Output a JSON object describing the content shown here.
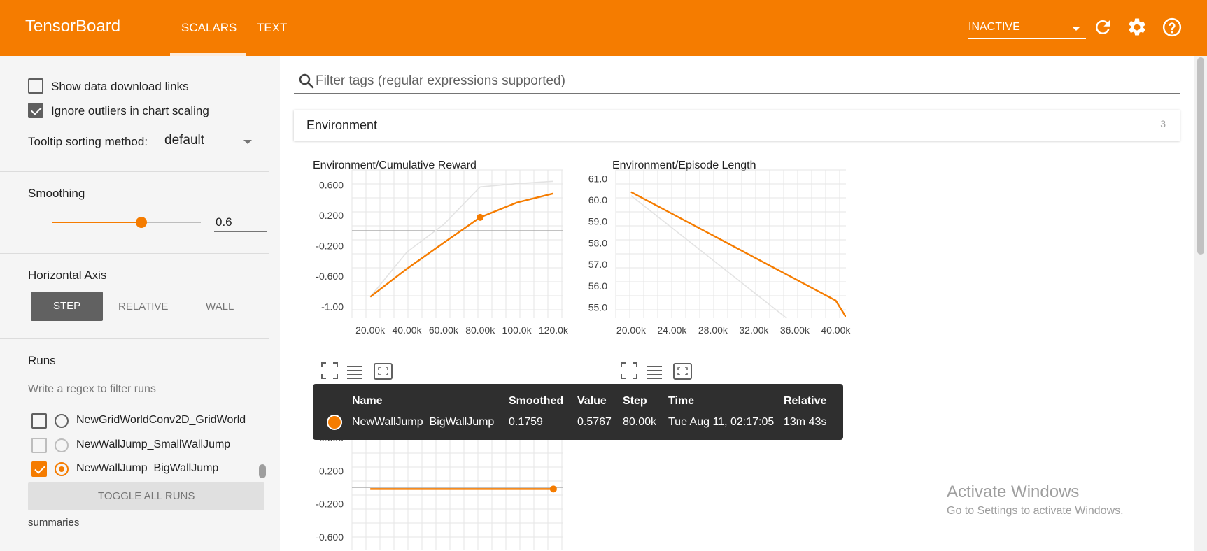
{
  "header": {
    "brand": "TensorBoard",
    "tabs": [
      {
        "label": "SCALARS",
        "active": true
      },
      {
        "label": "TEXT",
        "active": false
      }
    ],
    "status_select": "INACTIVE",
    "accent_color": "#f57c00"
  },
  "sidebar": {
    "show_download_links": {
      "label": "Show data download links",
      "checked": false
    },
    "ignore_outliers": {
      "label": "Ignore outliers in chart scaling",
      "checked": true
    },
    "tooltip_sorting": {
      "label": "Tooltip sorting method:",
      "value": "default"
    },
    "smoothing": {
      "label": "Smoothing",
      "value": "0.6",
      "slider_fraction": 0.6
    },
    "horizontal_axis": {
      "label": "Horizontal Axis",
      "options": [
        "STEP",
        "RELATIVE",
        "WALL"
      ],
      "selected": "STEP"
    },
    "runs": {
      "label": "Runs",
      "filter_placeholder": "Write a regex to filter runs",
      "items": [
        {
          "name": "NewGridWorldConv2D_GridWorld",
          "checked": false
        },
        {
          "name": "NewWallJump_SmallWallJump",
          "checked": false
        },
        {
          "name": "NewWallJump_BigWallJump",
          "checked": true
        }
      ],
      "toggle_label": "TOGGLE ALL RUNS",
      "footer": "summaries"
    }
  },
  "main": {
    "filter_placeholder": "Filter tags (regular expressions supported)",
    "section": {
      "title": "Environment",
      "count": "3"
    }
  },
  "chart_data": [
    {
      "type": "line",
      "title": "Environment/Cumulative Reward",
      "x_ticks": [
        "20.00k",
        "40.00k",
        "60.00k",
        "80.00k",
        "100.0k",
        "120.0k"
      ],
      "y_ticks": [
        "0.600",
        "0.200",
        "-0.200",
        "-0.600",
        "-1.00"
      ],
      "xlim": [
        10000,
        125000
      ],
      "ylim": [
        -1.15,
        0.8
      ],
      "series": [
        {
          "role": "smoothed",
          "color": "#f57c00",
          "x": [
            20000,
            40000,
            60000,
            80000,
            100000,
            120000
          ],
          "y": [
            -0.87,
            -0.5,
            -0.16,
            0.1759,
            0.37,
            0.49
          ]
        },
        {
          "role": "raw",
          "color": "#e3e3e3",
          "x": [
            20000,
            40000,
            60000,
            80000,
            100000,
            120000
          ],
          "y": [
            -0.87,
            -0.28,
            0.08,
            0.5767,
            0.62,
            0.65
          ]
        }
      ],
      "highlight": {
        "x": 80000,
        "y": 0.1759
      }
    },
    {
      "type": "line",
      "title": "Environment/Episode Length",
      "x_ticks": [
        "20.00k",
        "24.00k",
        "28.00k",
        "32.00k",
        "36.00k",
        "40.00k"
      ],
      "y_ticks": [
        "61.0",
        "60.0",
        "59.0",
        "58.0",
        "57.0",
        "56.0",
        "55.0"
      ],
      "xlim": [
        18500,
        41000
      ],
      "ylim": [
        54.5,
        61.4
      ],
      "series": [
        {
          "role": "smoothed",
          "color": "#f57c00",
          "x": [
            20000,
            40000,
            41000
          ],
          "y": [
            60.37,
            55.32,
            54.55
          ]
        },
        {
          "role": "raw",
          "color": "#e3e3e3",
          "x": [
            20000,
            35200
          ],
          "y": [
            60.2,
            54.5
          ]
        }
      ]
    },
    {
      "type": "line",
      "title": "",
      "y_ticks": [
        "0.600",
        "0.200",
        "-0.200",
        "-0.600"
      ],
      "ylim": [
        -0.75,
        0.75
      ],
      "series": [
        {
          "role": "smoothed",
          "color": "#f57c00",
          "x": [
            20000,
            120000
          ],
          "y": [
            -0.02,
            -0.02
          ]
        }
      ],
      "highlight": {
        "x": 120000,
        "y": -0.02
      }
    }
  ],
  "tooltip": {
    "headers": [
      "Name",
      "Smoothed",
      "Value",
      "Step",
      "Time",
      "Relative"
    ],
    "row": {
      "name": "NewWallJump_BigWallJump",
      "smoothed": "0.1759",
      "value": "0.5767",
      "step": "80.00k",
      "time": "Tue Aug 11, 02:17:05",
      "relative": "13m 43s",
      "color": "#f57c00"
    }
  },
  "watermark": {
    "title": "Activate Windows",
    "subtitle": "Go to Settings to activate Windows."
  }
}
